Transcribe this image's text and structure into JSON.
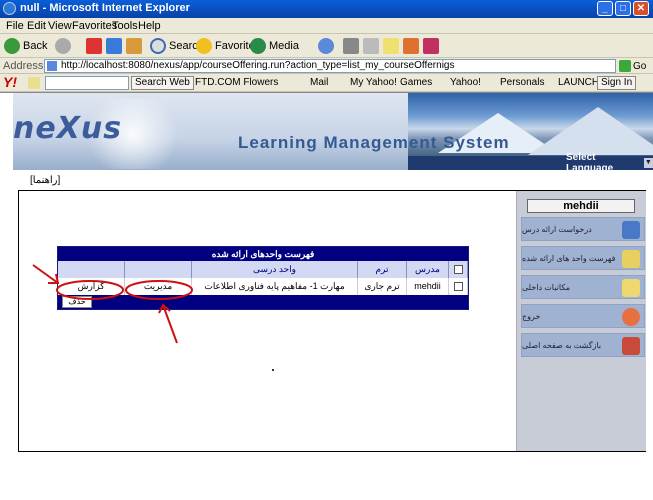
{
  "window": {
    "title": "null - Microsoft Internet Explorer"
  },
  "menu": [
    "File",
    "Edit",
    "View",
    "Favorites",
    "Tools",
    "Help"
  ],
  "toolbar": {
    "back": "Back",
    "search": "Search",
    "favorites": "Favorites",
    "media": "Media"
  },
  "address": {
    "label": "Address",
    "url": "http://localhost:8080/nexus/app/courseOffering.run?action_type=list_my_courseOffernigs",
    "go": "Go"
  },
  "yahoo": {
    "logo": "Y!",
    "search_btn": "Search Web",
    "links": [
      "FTD.COM Flowers",
      "Mail",
      "My Yahoo!",
      "Games",
      "Yahoo!",
      "Personals",
      "LAUNCH"
    ],
    "signin": "Sign In"
  },
  "banner": {
    "logo": "neXus",
    "title": "Learning Management System",
    "language": "Select Language"
  },
  "help_link": "[راهنما]",
  "sidebar": {
    "user": "mehdii",
    "items": [
      "درخواست ارائه درس",
      "فهرست واحد های ارائه شده",
      "مکاتبات داخلی",
      "خروج",
      "بازگشت به صفحه اصلی"
    ]
  },
  "grid": {
    "title": "فهرست واحدهای ارائه شده",
    "columns": {
      "teacher": "مدرس",
      "term": "ترم",
      "unit": "واحد درسی"
    },
    "rows": [
      {
        "teacher": "mehdii",
        "term": "ترم جاری",
        "unit": "مهارت 1- مفاهیم پایه فناوری اطلاعات",
        "manage": "مدیریت",
        "report": "گزارش"
      }
    ],
    "delete": "حذف"
  }
}
